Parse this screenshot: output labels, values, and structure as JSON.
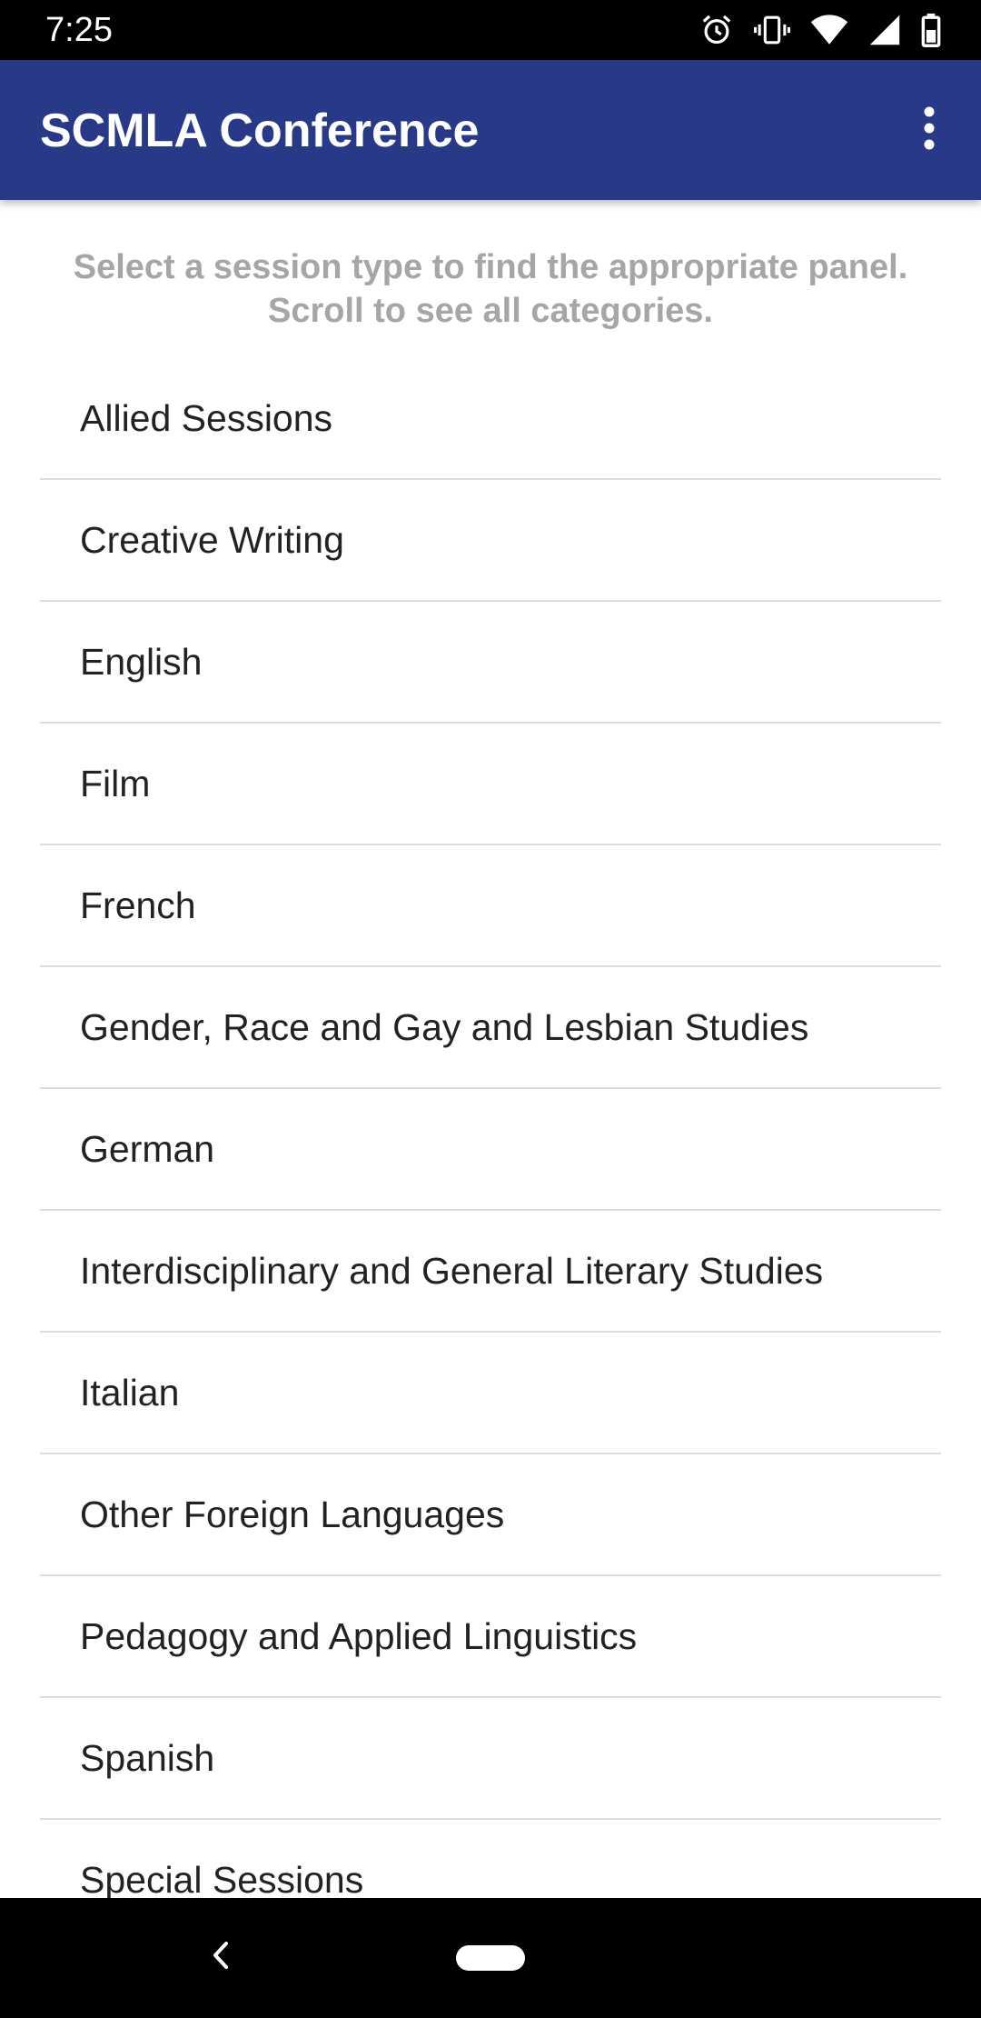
{
  "status_bar": {
    "time": "7:25",
    "icons": [
      "alarm-icon",
      "vibrate-icon",
      "wifi-icon",
      "signal-icon",
      "battery-icon"
    ]
  },
  "app_bar": {
    "title": "SCMLA Conference",
    "menu_icon": "more-vert-icon",
    "color": "#283a87"
  },
  "instructions": {
    "line1": "Select a session type to find the appropriate panel.",
    "line2": "Scroll to see all categories."
  },
  "sessions": [
    {
      "label": "Allied Sessions"
    },
    {
      "label": "Creative Writing"
    },
    {
      "label": "English"
    },
    {
      "label": "Film"
    },
    {
      "label": "French"
    },
    {
      "label": "Gender, Race and Gay and Lesbian Studies"
    },
    {
      "label": "German"
    },
    {
      "label": "Interdisciplinary and General Literary Studies"
    },
    {
      "label": "Italian"
    },
    {
      "label": "Other Foreign Languages"
    },
    {
      "label": "Pedagogy and Applied Linguistics"
    },
    {
      "label": "Spanish"
    },
    {
      "label": "Special Sessions"
    }
  ],
  "nav_bar": {
    "back_icon": "back-chevron-icon",
    "home_icon": "home-pill-icon"
  }
}
